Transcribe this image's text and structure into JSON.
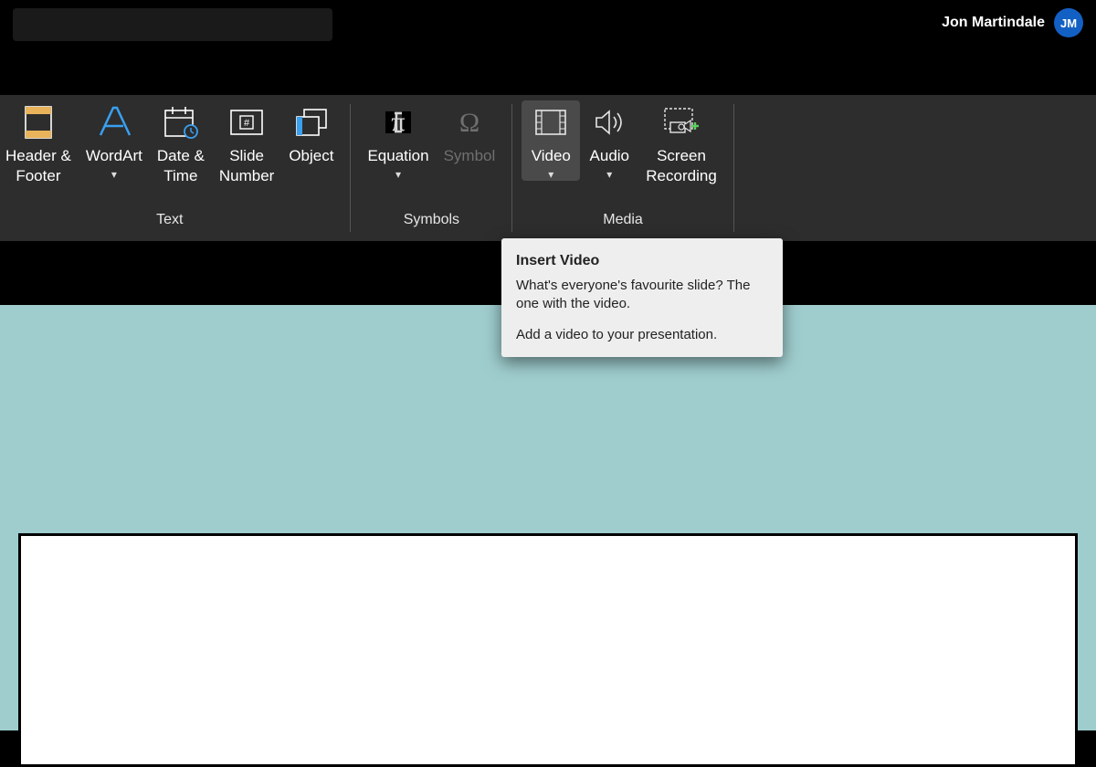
{
  "user": {
    "name": "Jon Martindale",
    "initials": "JM"
  },
  "ribbon": {
    "groups": {
      "text": {
        "label": "Text",
        "buttons": {
          "header_footer": "Header &\nFooter",
          "wordart": "WordArt",
          "date_time": "Date &\nTime",
          "slide_number": "Slide\nNumber",
          "object": "Object"
        }
      },
      "symbols": {
        "label": "Symbols",
        "buttons": {
          "equation": "Equation",
          "symbol": "Symbol"
        }
      },
      "media": {
        "label": "Media",
        "buttons": {
          "video": "Video",
          "audio": "Audio",
          "screen_recording": "Screen\nRecording"
        }
      }
    }
  },
  "tooltip": {
    "title": "Insert Video",
    "line1": "What's everyone's favourite slide? The one with the video.",
    "line2": "Add a video to your presentation."
  }
}
